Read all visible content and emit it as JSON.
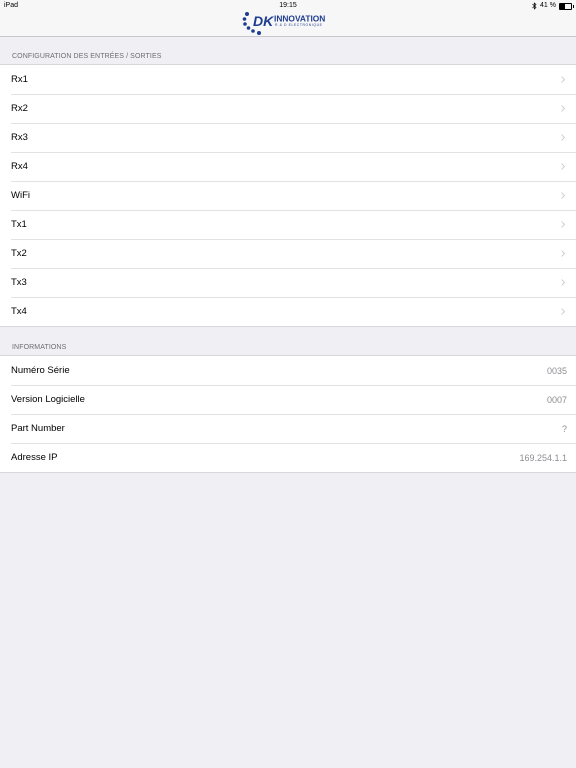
{
  "status_bar": {
    "device": "iPad",
    "time": "19:15",
    "battery_text": "41 %",
    "battery_level": 0.41
  },
  "nav_bar": {
    "logo_text": "DK INNOVATION",
    "logo_tagline": "R & D ELECTRONIQUE",
    "logo_icon": "dk-innovation-logo"
  },
  "io_section": {
    "header": "CONFIGURATION DES ENTRÉES / SORTIES",
    "items": [
      {
        "label": "Rx1"
      },
      {
        "label": "Rx2"
      },
      {
        "label": "Rx3"
      },
      {
        "label": "Rx4"
      },
      {
        "label": "WiFi"
      },
      {
        "label": "Tx1"
      },
      {
        "label": "Tx2"
      },
      {
        "label": "Tx3"
      },
      {
        "label": "Tx4"
      }
    ]
  },
  "info_section": {
    "header": "INFORMATIONS",
    "items": [
      {
        "label": "Numéro Série",
        "value": "0035"
      },
      {
        "label": "Version Logicielle",
        "value": "0007"
      },
      {
        "label": "Part Number",
        "value": "?"
      },
      {
        "label": "Adresse IP",
        "value": "169.254.1.1"
      }
    ]
  },
  "colors": {
    "background": "#efeff4",
    "logo_blue": "#1f3d8f",
    "chevron": "#c7c7cc",
    "secondary_text": "#8e8e93"
  }
}
